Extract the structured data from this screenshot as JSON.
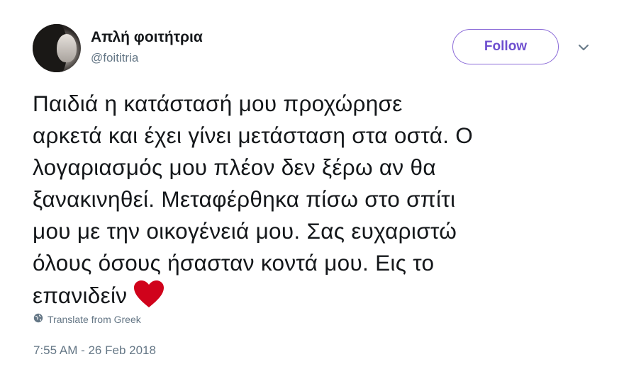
{
  "user": {
    "display_name": "Απλή φοιτήτρια",
    "handle": "@foititria"
  },
  "follow_label": "Follow",
  "tweet": {
    "lines": [
      "Παιδιά η κατάστασή μου προχώρησε",
      "αρκετά και έχει γίνει μετάσταση στα οστά. Ο",
      "λογαριασμός μου πλέον δεν ξέρω αν θα",
      "ξανακινηθεί. Μεταφέρθηκα πίσω στο σπίτι",
      "μου με την οικογένειά μου. Σας ευχαριστώ",
      "όλους όσους ήσασταν κοντά μου. Εις το",
      "επανιδείν"
    ],
    "emoji": "heart-icon"
  },
  "translate_label": "Translate from Greek",
  "timestamp": "7:55 AM - 26 Feb 2018",
  "colors": {
    "accent": "#6e4fcf",
    "secondary_text": "#657786",
    "heart": "#d0021b"
  }
}
